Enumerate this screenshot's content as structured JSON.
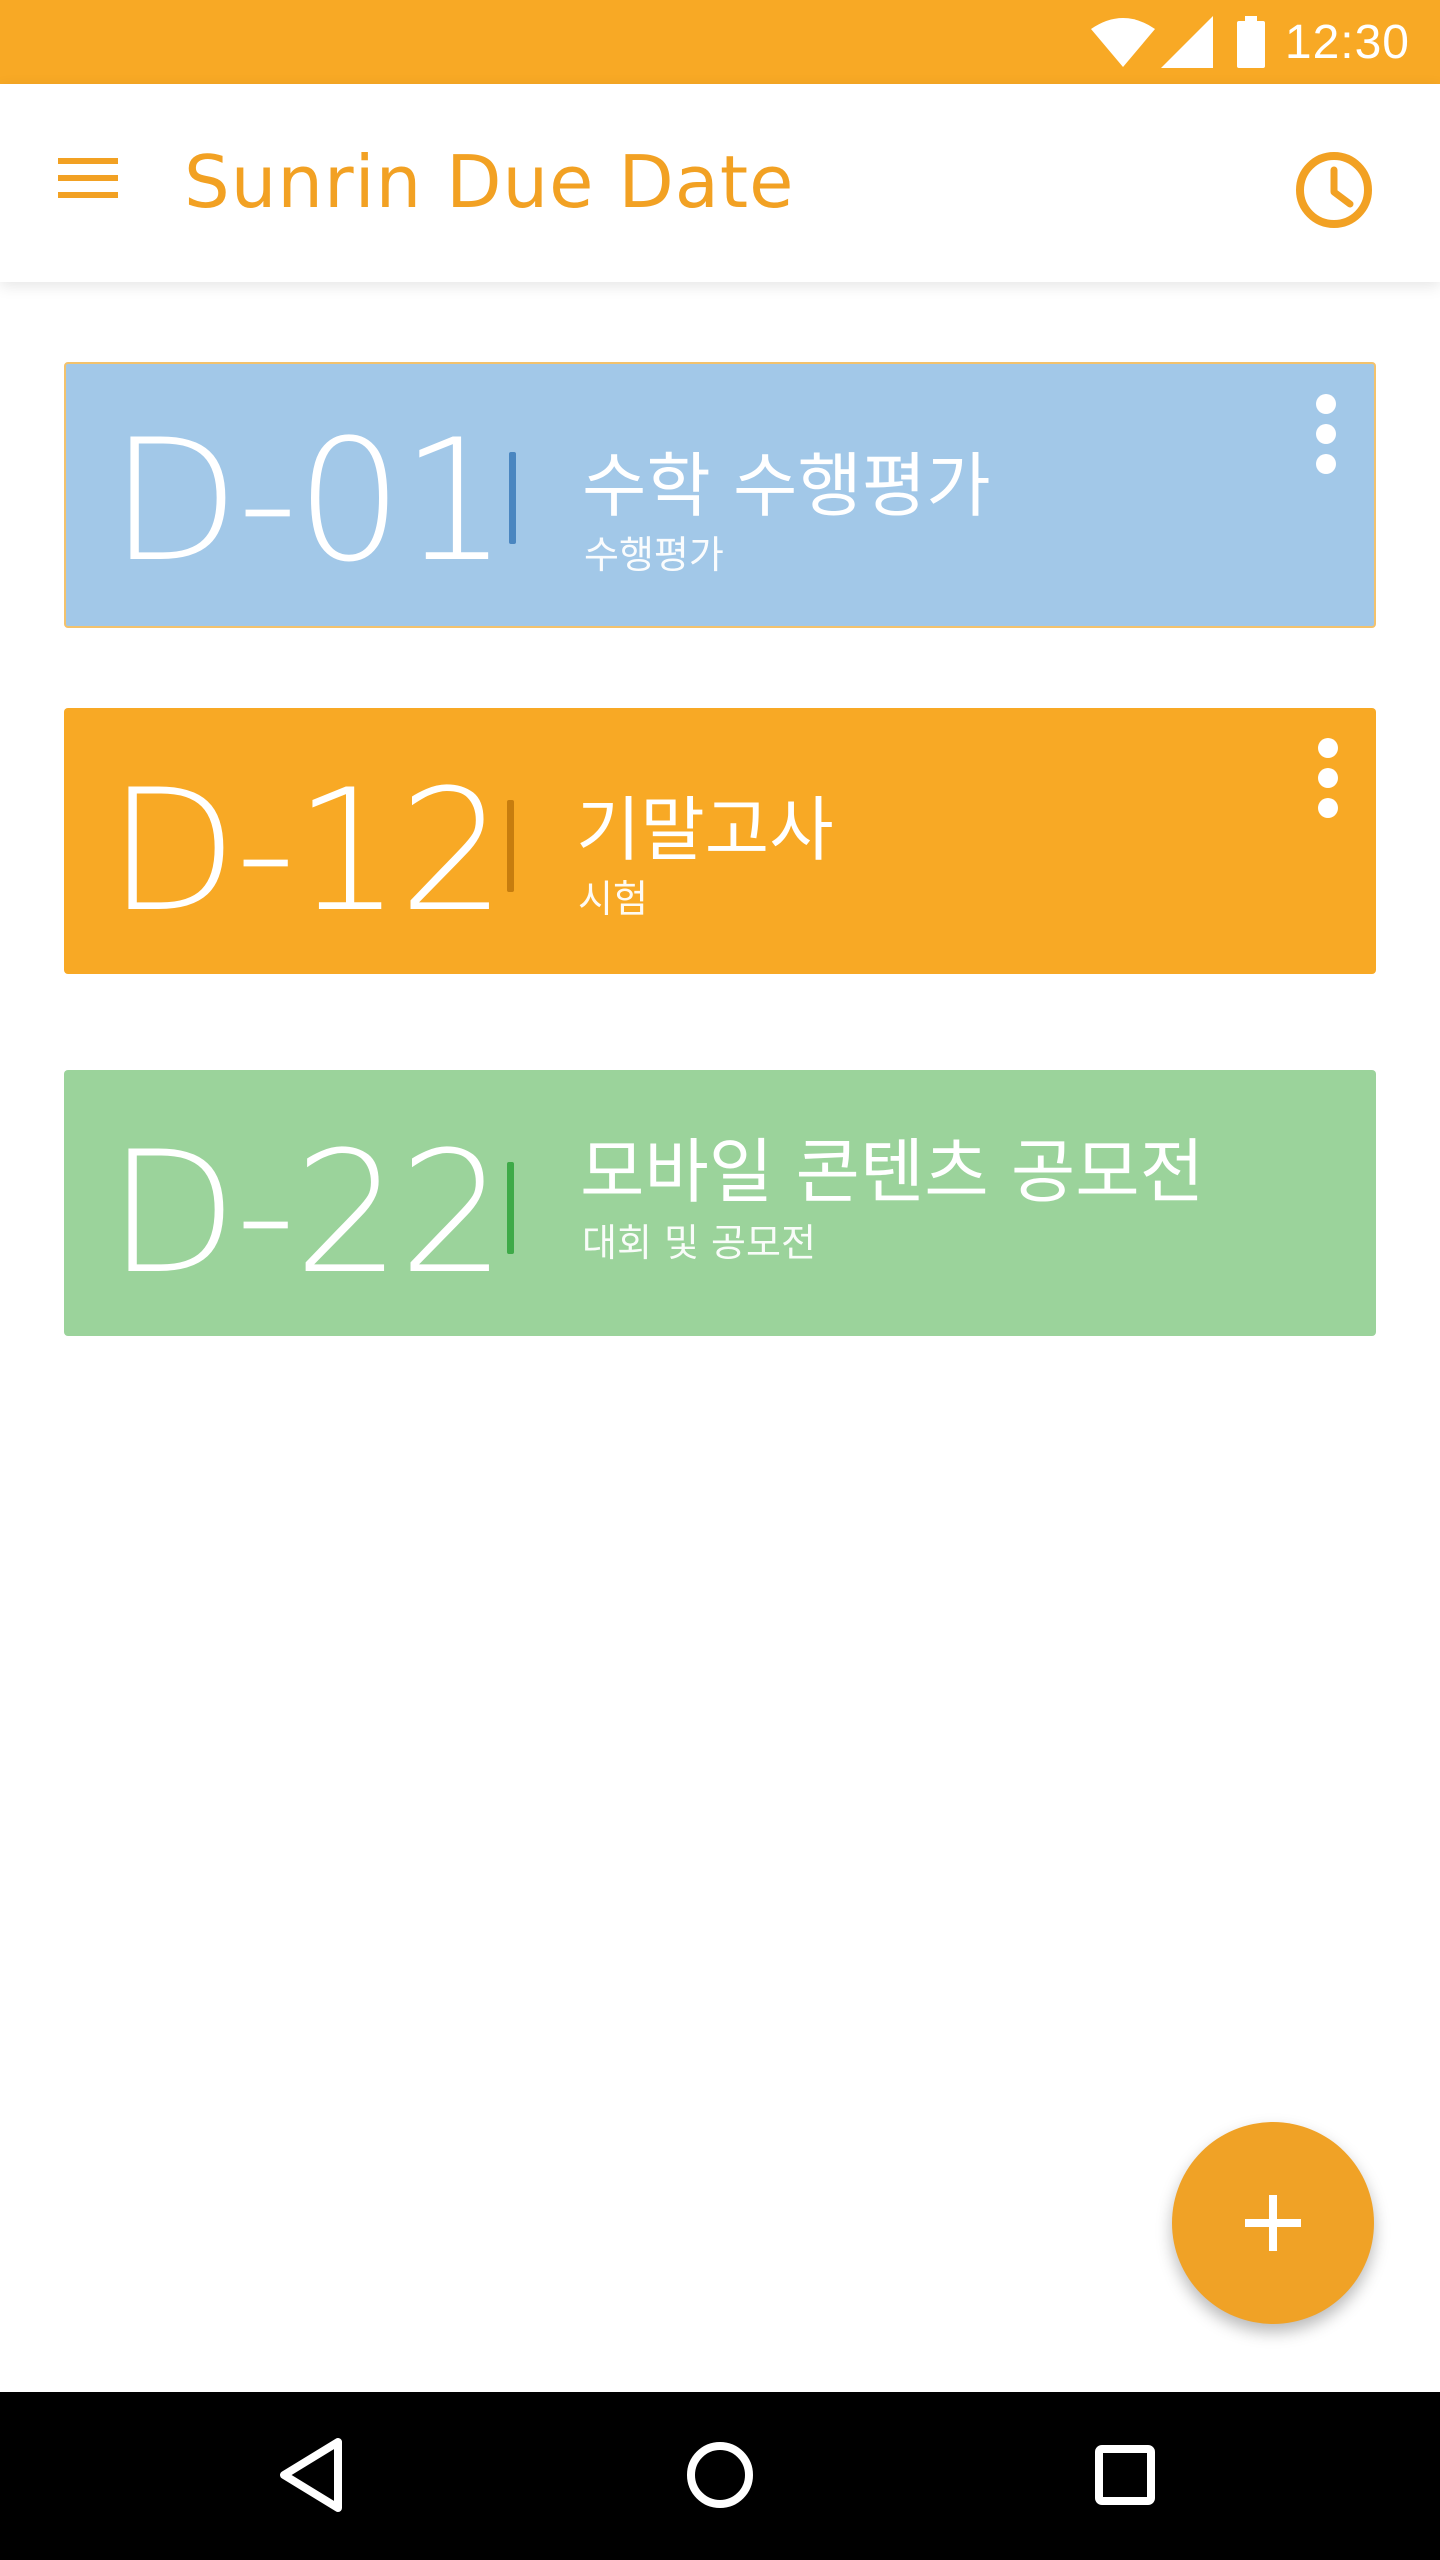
{
  "status_bar": {
    "time": "12:30",
    "icons": [
      "wifi-icon",
      "cell-signal-icon",
      "battery-icon"
    ],
    "bg_color": "#F8A925"
  },
  "app_bar": {
    "title": "Sunrin Due Date",
    "menu_icon": "hamburger-menu-icon",
    "action_icon": "clock-icon",
    "accent_color": "#F2A123"
  },
  "cards": [
    {
      "dday": "D-01",
      "title": "수학 수행평가",
      "subtitle": "수행평가",
      "color": "#A2C8E8",
      "divider_color": "#4A86C0",
      "has_more": true
    },
    {
      "dday": "D-12",
      "title": "기말고사",
      "subtitle": "시험",
      "color": "#F8A925",
      "divider_color": "#C77D0E",
      "has_more": true
    },
    {
      "dday": "D-22",
      "title": "모바일 콘텐츠 공모전",
      "subtitle": "대회 및 공모전",
      "color": "#9BD39B",
      "divider_color": "#3EAA48",
      "has_more": false
    }
  ],
  "fab": {
    "icon": "plus-icon",
    "color": "#F0A226"
  },
  "nav_bar": {
    "buttons": [
      "back-icon",
      "home-icon",
      "recents-icon"
    ]
  }
}
